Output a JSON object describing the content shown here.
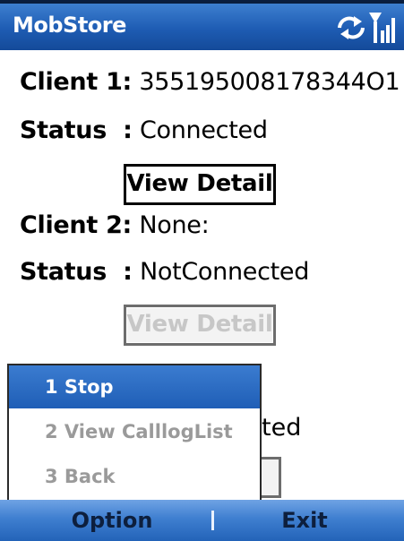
{
  "app": {
    "title": "MobStore"
  },
  "status_icons": [
    "sync-icon",
    "signal-icon"
  ],
  "clients": [
    {
      "client_label": "Client 1:",
      "client_value": "355195008178344O1",
      "status_label": "Status  :",
      "status_value": "Connected",
      "button_label": "View Detail",
      "button_enabled": true
    },
    {
      "client_label": "Client 2:",
      "client_value": "None:",
      "status_label": "Status  :",
      "status_value": "NotConnected",
      "button_label": "View Detail",
      "button_enabled": false
    },
    {
      "client_value_partial": "ted"
    }
  ],
  "menu": {
    "items": [
      {
        "label": "1 Stop",
        "selected": true
      },
      {
        "label": "2 View CalllogList",
        "selected": false
      },
      {
        "label": "3 Back",
        "selected": false
      }
    ]
  },
  "softkeys": {
    "left": "Option",
    "right": "Exit"
  },
  "colors": {
    "accent": "#1e5cb3",
    "softbar": "#3f7fd0",
    "disabled_text": "#c7c7c7"
  }
}
